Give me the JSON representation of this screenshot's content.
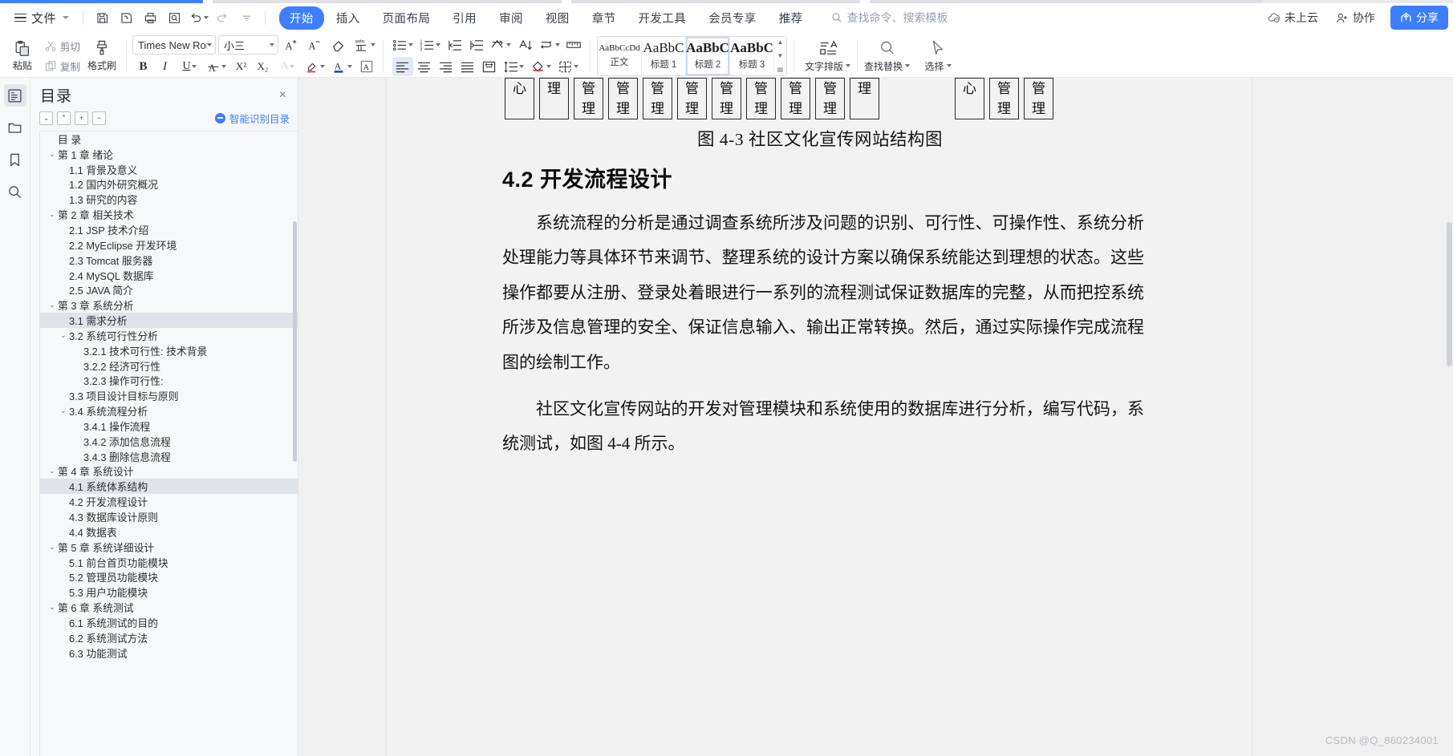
{
  "app": {
    "product": "WPS Office"
  },
  "menubar": {
    "file_label": "文件",
    "quick_access": [
      {
        "name": "save-icon",
        "title": "保存"
      },
      {
        "name": "save-as-icon",
        "title": "另存为"
      },
      {
        "name": "print-icon",
        "title": "打印"
      },
      {
        "name": "print-preview-icon",
        "title": "打印预览"
      },
      {
        "name": "undo-icon",
        "title": "撤销"
      },
      {
        "name": "redo-icon",
        "title": "恢复"
      },
      {
        "name": "customize-qat-icon",
        "title": "自定义快速访问工具栏"
      }
    ],
    "tabs": [
      {
        "label": "开始",
        "active": true
      },
      {
        "label": "插入",
        "active": false
      },
      {
        "label": "页面布局",
        "active": false
      },
      {
        "label": "引用",
        "active": false
      },
      {
        "label": "审阅",
        "active": false
      },
      {
        "label": "视图",
        "active": false
      },
      {
        "label": "章节",
        "active": false
      },
      {
        "label": "开发工具",
        "active": false
      },
      {
        "label": "会员专享",
        "active": false
      },
      {
        "label": "推荐",
        "active": false
      }
    ],
    "search_placeholder": "查找命令、搜索模板",
    "cloud_status": "未上云",
    "collaborate": "协作",
    "share": "分享"
  },
  "ribbon": {
    "paste": "粘贴",
    "cut": "剪切",
    "copy": "复制",
    "format_painter": "格式刷",
    "font_name": "Times New Roma",
    "font_size": "小三",
    "grow_font": "A⁺",
    "shrink_font": "A⁻",
    "clear_format": "清除格式",
    "pinyin": "拼音指南",
    "bold": "B",
    "italic": "I",
    "underline": "U",
    "strikethrough": "A",
    "superscript": "X²",
    "subscript": "X₂",
    "text_effect": "A",
    "highlight": "文本突出显示",
    "font_color": "字体颜色",
    "char_border": "字符边框",
    "styles": [
      {
        "preview": "AaBbCcDd",
        "name": "正文",
        "selected": false
      },
      {
        "preview": "AaBbC",
        "name": "标题 1",
        "selected": false
      },
      {
        "preview": "AaBbC",
        "name": "标题 2",
        "selected": true
      },
      {
        "preview": "AaBbC",
        "name": "标题 3",
        "selected": false
      }
    ],
    "text_layout": "文字排版",
    "find_replace": "查找替换",
    "select": "选择"
  },
  "rail": {
    "items": [
      {
        "name": "toc-rail-icon",
        "label": "目录",
        "active": true
      },
      {
        "name": "chapter-nav-rail-icon",
        "label": "章节导航",
        "active": false
      },
      {
        "name": "bookmark-rail-icon",
        "label": "书签",
        "active": false
      },
      {
        "name": "search-rail-icon",
        "label": "查找",
        "active": false
      }
    ]
  },
  "toc": {
    "title": "目录",
    "close": "×",
    "tools": [
      {
        "name": "expand-down-button",
        "glyph": "⌄"
      },
      {
        "name": "collapse-up-button",
        "glyph": "⌃"
      },
      {
        "name": "expand-all-button",
        "glyph": "+"
      },
      {
        "name": "collapse-all-button",
        "glyph": "−"
      }
    ],
    "smart_recognize": "智能识别目录",
    "items": [
      {
        "label": "目 录",
        "level": 1,
        "arrow": "",
        "selected": false
      },
      {
        "label": "第 1 章 绪论",
        "level": 1,
        "arrow": "⌄",
        "selected": false
      },
      {
        "label": "1.1 背景及意义",
        "level": 2,
        "arrow": "",
        "selected": false
      },
      {
        "label": "1.2 国内外研究概况",
        "level": 2,
        "arrow": "",
        "selected": false
      },
      {
        "label": "1.3 研究的内容",
        "level": 2,
        "arrow": "",
        "selected": false
      },
      {
        "label": "第 2 章 相关技术",
        "level": 1,
        "arrow": "⌄",
        "selected": false
      },
      {
        "label": "2.1 JSP 技术介绍",
        "level": 2,
        "arrow": "",
        "selected": false
      },
      {
        "label": "2.2 MyEclipse 开发环境",
        "level": 2,
        "arrow": "",
        "selected": false
      },
      {
        "label": "2.3 Tomcat 服务器",
        "level": 2,
        "arrow": "",
        "selected": false
      },
      {
        "label": "2.4 MySQL 数据库",
        "level": 2,
        "arrow": "",
        "selected": false
      },
      {
        "label": "2.5 JAVA 简介",
        "level": 2,
        "arrow": "",
        "selected": false
      },
      {
        "label": "第 3 章 系统分析",
        "level": 1,
        "arrow": "⌄",
        "selected": false
      },
      {
        "label": "3.1 需求分析",
        "level": 2,
        "arrow": "",
        "selected": true
      },
      {
        "label": "3.2 系统可行性分析",
        "level": 2,
        "arrow": "⌄",
        "selected": false
      },
      {
        "label": "3.2.1 技术可行性: 技术背景",
        "level": 3,
        "arrow": "",
        "selected": false
      },
      {
        "label": "3.2.2 经济可行性",
        "level": 3,
        "arrow": "",
        "selected": false
      },
      {
        "label": "3.2.3 操作可行性:",
        "level": 3,
        "arrow": "",
        "selected": false
      },
      {
        "label": "3.3 项目设计目标与原则",
        "level": 2,
        "arrow": "",
        "selected": false
      },
      {
        "label": "3.4 系统流程分析",
        "level": 2,
        "arrow": "⌄",
        "selected": false
      },
      {
        "label": "3.4.1 操作流程",
        "level": 3,
        "arrow": "",
        "selected": false
      },
      {
        "label": "3.4.2 添加信息流程",
        "level": 3,
        "arrow": "",
        "selected": false
      },
      {
        "label": "3.4.3 删除信息流程",
        "level": 3,
        "arrow": "",
        "selected": false
      },
      {
        "label": "第 4 章 系统设计",
        "level": 1,
        "arrow": "⌄",
        "selected": false
      },
      {
        "label": "4.1 系统体系结构",
        "level": 2,
        "arrow": "",
        "selected": true
      },
      {
        "label": "4.2 开发流程设计",
        "level": 2,
        "arrow": "",
        "selected": false
      },
      {
        "label": "4.3 数据库设计原则",
        "level": 2,
        "arrow": "",
        "selected": false
      },
      {
        "label": "4.4 数据表",
        "level": 2,
        "arrow": "",
        "selected": false
      },
      {
        "label": "第 5 章 系统详细设计",
        "level": 1,
        "arrow": "⌄",
        "selected": false
      },
      {
        "label": "5.1 前台首页功能模块",
        "level": 2,
        "arrow": "",
        "selected": false
      },
      {
        "label": "5.2 管理员功能模块",
        "level": 2,
        "arrow": "",
        "selected": false
      },
      {
        "label": "5.3 用户功能模块",
        "level": 2,
        "arrow": "",
        "selected": false
      },
      {
        "label": "第 6 章  系统测试",
        "level": 1,
        "arrow": "⌄",
        "selected": false
      },
      {
        "label": "6.1 系统测试的目的",
        "level": 2,
        "arrow": "",
        "selected": false
      },
      {
        "label": "6.2 系统测试方法",
        "level": 2,
        "arrow": "",
        "selected": false
      },
      {
        "label": "6.3 功能测试",
        "level": 2,
        "arrow": "",
        "selected": false
      }
    ]
  },
  "document": {
    "chart_boxes": [
      "心",
      "理",
      "管理",
      "管理",
      "管理",
      "管理",
      "管理",
      "管理",
      "管理",
      "管理",
      "理"
    ],
    "chart_boxes_right": [
      "心",
      "管理",
      "管理"
    ],
    "figure_caption": "图 4-3  社区文化宣传网站结构图",
    "heading": "4.2 开发流程设计",
    "paragraph1": "系统流程的分析是通过调查系统所涉及问题的识别、可行性、可操作性、系统分析处理能力等具体环节来调节、整理系统的设计方案以确保系统能达到理想的状态。这些操作都要从注册、登录处着眼进行一系列的流程测试保证数据库的完整，从而把控系统所涉及信息管理的安全、保证信息输入、输出正常转换。然后，通过实际操作完成流程图的绘制工作。",
    "paragraph2": "社区文化宣传网站的开发对管理模块和系统使用的数据库进行分析，编写代码，系统测试，如图 4-4 所示。",
    "watermark": "CSDN @Q_860234001"
  },
  "colors": {
    "accent": "#3e7eff",
    "ribbon_bg": "#ffffff",
    "panel_bg": "#f7f8fa",
    "page_bg": "#f2f2f2",
    "doc_bg": "#f0f0f0",
    "selection": "#e0e3e8"
  }
}
